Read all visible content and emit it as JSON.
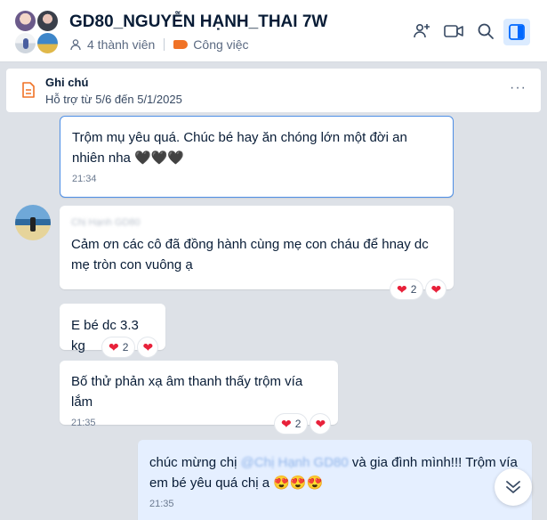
{
  "header": {
    "title": "GD80_NGUYỄN HẠNH_THAI 7W",
    "members": "4 thành viên",
    "category": "Công việc"
  },
  "note": {
    "title": "Ghi chú",
    "desc": "Hỗ trợ từ 5/6 đến 5/1/2025",
    "more": "···"
  },
  "messages": [
    {
      "text": "Trộm mụ yêu quá. Chúc bé hay ăn chóng lớn một đời an nhiên nha 🖤🖤🖤",
      "time": "21:34"
    },
    {
      "sender": "Chị Hạnh GD80",
      "text": "Cảm ơn các cô đã đồng hành cùng mẹ con cháu để hnay dc mẹ tròn con vuông ạ",
      "reactions": "2"
    },
    {
      "text": "E bé dc 3.3 kg",
      "reactions": "2"
    },
    {
      "text": "Bố thử phản xạ âm thanh thấy trộm vía lắm",
      "time": "21:35",
      "reactions": "2"
    },
    {
      "prefix": "chúc mừng chị ",
      "mention": "@Chị Hạnh GD80",
      "suffix": " và gia đình mình!!! Trộm vía em bé yêu quá chị a 😍😍😍",
      "time": "21:35"
    }
  ],
  "colors": {
    "accent": "#0068ff",
    "heart": "#e8213a",
    "own_bubble": "#e5efff"
  }
}
